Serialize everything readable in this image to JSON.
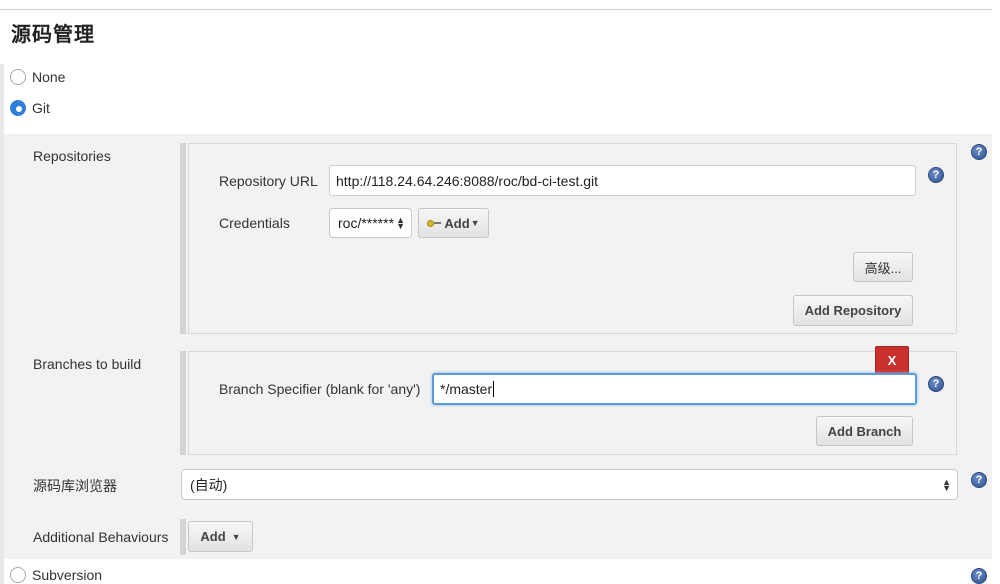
{
  "section": {
    "title": "源码管理"
  },
  "scm_options": [
    {
      "label": "None",
      "selected": false
    },
    {
      "label": "Git",
      "selected": true
    },
    {
      "label": "Subversion",
      "selected": false
    }
  ],
  "git": {
    "repositories_label": "Repositories",
    "repository_url_label": "Repository URL",
    "repository_url_value": "http://118.24.64.246:8088/roc/bd-ci-test.git",
    "credentials_label": "Credentials",
    "credentials_value": "roc/******",
    "credentials_add_label": "Add",
    "advanced_label": "高级...",
    "add_repository_label": "Add Repository",
    "branches_label": "Branches to build",
    "delete_branch_label": "X",
    "branch_specifier_label": "Branch Specifier (blank for 'any')",
    "branch_specifier_value": "*/master",
    "add_branch_label": "Add Branch",
    "browser_label": "源码库浏览器",
    "browser_value": "(自动)",
    "additional_behaviours_label": "Additional Behaviours",
    "add_behaviour_label": "Add"
  },
  "icons": {
    "help": "help-icon",
    "key": "key-icon",
    "dropdown": "caret-down-icon"
  },
  "colors": {
    "accent": "#2f7fd8",
    "delete": "#c9302c",
    "panel_bg": "#f2f2f2",
    "help": "#2e4f8f"
  }
}
